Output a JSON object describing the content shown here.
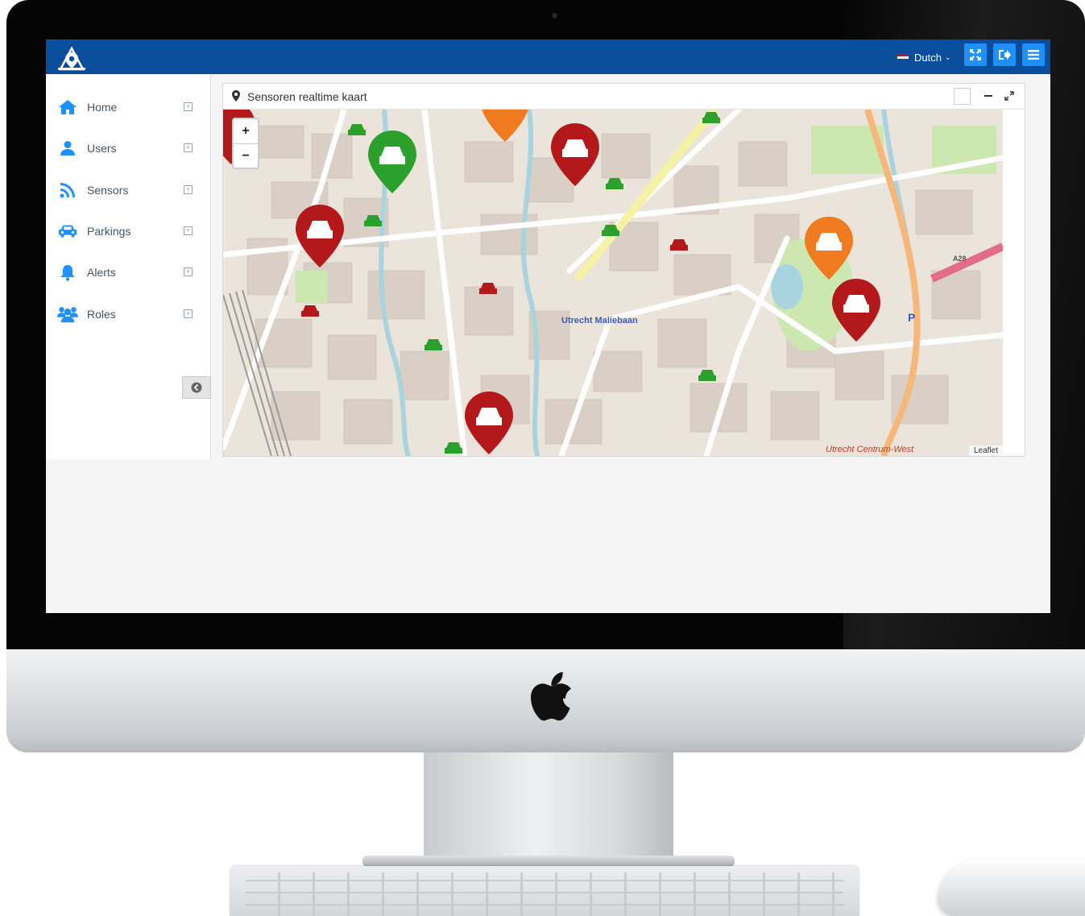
{
  "header": {
    "language": "Dutch",
    "brand_color": "#0a4d9a",
    "button_color": "#1e90ff",
    "buttons": [
      {
        "icon": "fullscreen-icon"
      },
      {
        "icon": "logout-icon"
      },
      {
        "icon": "menu-icon"
      }
    ]
  },
  "sidebar": {
    "items": [
      {
        "label": "Home",
        "icon": "home-icon"
      },
      {
        "label": "Users",
        "icon": "user-icon"
      },
      {
        "label": "Sensors",
        "icon": "rss-icon"
      },
      {
        "label": "Parkings",
        "icon": "car-icon"
      },
      {
        "label": "Alerts",
        "icon": "bell-icon"
      },
      {
        "label": "Roles",
        "icon": "users-group-icon"
      }
    ],
    "icon_color": "#1e90ff",
    "collapse_icon": "chevron-left-circle-icon"
  },
  "panel": {
    "title": "Sensoren realtime kaart",
    "tools": [
      "checkbox",
      "minimize-icon",
      "expand-icon"
    ]
  },
  "map": {
    "zoom_in": "+",
    "zoom_out": "−",
    "attribution": "Leaflet",
    "labels": [
      "Utrecht Maliebaan",
      "Utrecht Centrum-West",
      "A28",
      "P"
    ],
    "marker_colors": {
      "free": "#2ca02c",
      "busy": "#b3191b",
      "warning": "#f07a1f"
    }
  }
}
